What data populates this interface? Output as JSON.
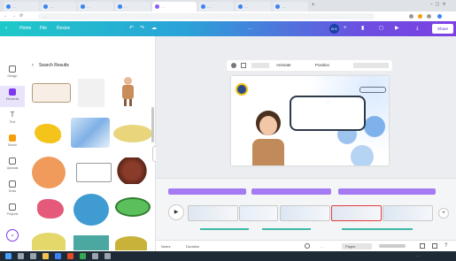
{
  "browser": {
    "tabs": [
      {
        "label": "…",
        "active": false
      },
      {
        "label": "…",
        "active": false
      },
      {
        "label": "…",
        "active": false
      },
      {
        "label": "…",
        "active": false
      },
      {
        "label": "…",
        "active": true
      },
      {
        "label": "…",
        "active": false
      },
      {
        "label": "…",
        "active": false
      },
      {
        "label": "…",
        "active": false
      }
    ],
    "url": "…"
  },
  "topbar": {
    "home": "Home",
    "file": "File",
    "resize": "Resize",
    "design_title": "…",
    "avatar_initials": "B.S",
    "share": "Share",
    "colors": {
      "start": "#1ec9c9",
      "end": "#7d3fe3"
    }
  },
  "leftnav": {
    "items": [
      {
        "label": "Design",
        "icon": "layout-icon"
      },
      {
        "label": "Elements",
        "icon": "shapes-icon"
      },
      {
        "label": "Text",
        "icon": "text-icon"
      },
      {
        "label": "Brand",
        "icon": "crown-icon"
      },
      {
        "label": "Uploads",
        "icon": "upload-icon"
      },
      {
        "label": "Draw",
        "icon": "pen-icon"
      },
      {
        "label": "Projects",
        "icon": "folder-icon"
      },
      {
        "label": "Apps",
        "icon": "apps-icon"
      }
    ]
  },
  "panel": {
    "title": "Search Results"
  },
  "editor": {
    "toolbar": {
      "animate": "Animate",
      "position": "Position"
    },
    "slide": {
      "speech_text": "…"
    }
  },
  "timeline": {
    "segments": [
      "",
      "",
      ""
    ],
    "labels": [
      "",
      "",
      ""
    ]
  },
  "bottombar": {
    "notes": "Notes",
    "duration": "Duration",
    "zoom": "…",
    "pages": "Pages"
  },
  "taskbar": {
    "clock": "…"
  }
}
